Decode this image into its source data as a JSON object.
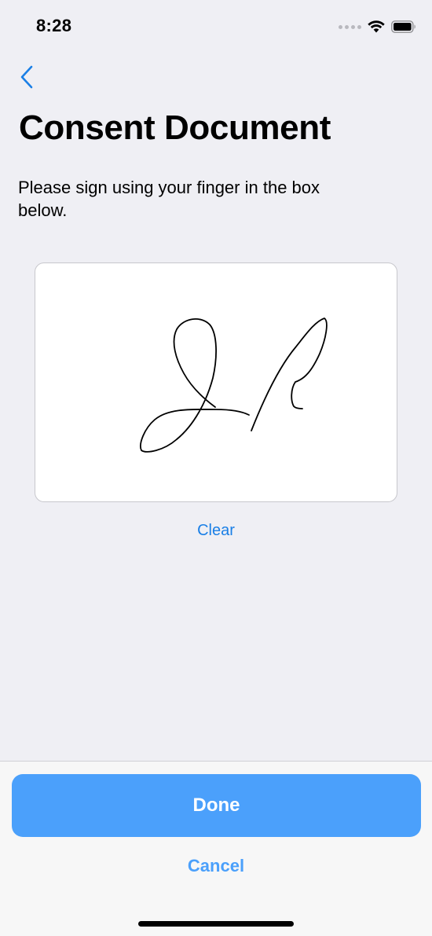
{
  "status_bar": {
    "time": "8:28",
    "icons": [
      "signal-dots-icon",
      "wifi-icon",
      "battery-icon"
    ]
  },
  "nav": {
    "back_icon": "chevron-left-icon"
  },
  "page": {
    "title": "Consent Document",
    "instructions": "Please sign using your finger in the box below."
  },
  "signature": {
    "has_signature": true,
    "clear_label": "Clear"
  },
  "footer": {
    "done_label": "Done",
    "cancel_label": "Cancel"
  },
  "colors": {
    "accent": "#1a7fe6",
    "primary_button": "#4ba0fb",
    "background": "#efeff4",
    "pad_border": "#c7c7cc"
  }
}
